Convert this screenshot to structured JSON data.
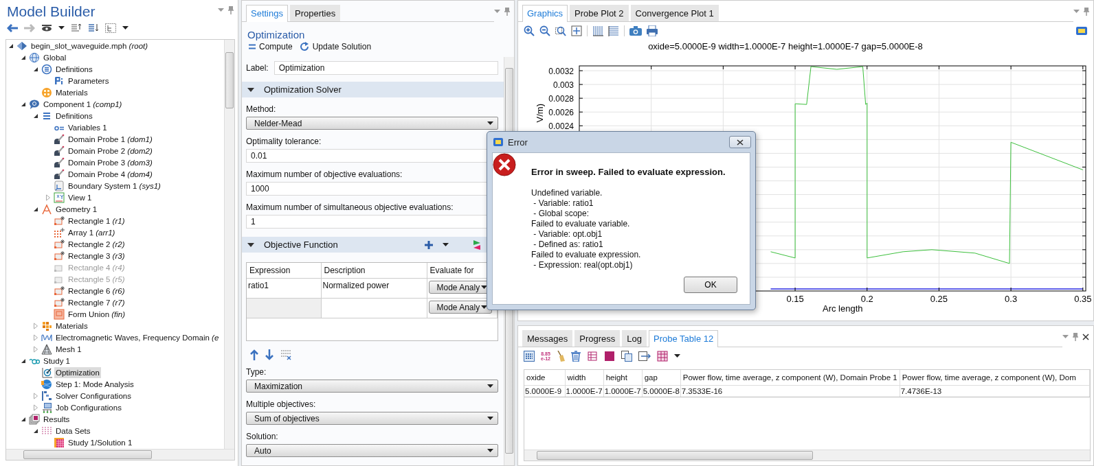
{
  "model_builder": {
    "title": "Model Builder",
    "tree": [
      {
        "label": "begin_slot_waveguide.mph *(root)*",
        "kind": "file",
        "selected": false,
        "expanded": true,
        "children": [
          {
            "label": "Global",
            "kind": "globe",
            "selected": false,
            "expanded": true,
            "children": [
              {
                "label": "Definitions",
                "kind": "definitions",
                "selected": false,
                "expanded": true,
                "children": [
                  {
                    "label": "Parameters",
                    "kind": "parameters",
                    "selected": false
                  }
                ]
              },
              {
                "label": "Materials",
                "kind": "materials",
                "selected": false
              }
            ]
          },
          {
            "label": "Component 1 *(comp1)*",
            "kind": "component",
            "selected": false,
            "expanded": true,
            "children": [
              {
                "label": "Definitions",
                "kind": "list",
                "selected": false,
                "expanded": true,
                "children": [
                  {
                    "label": "Variables 1",
                    "kind": "variables",
                    "selected": false
                  },
                  {
                    "label": "Domain Probe 1 *(dom1)*",
                    "kind": "probe",
                    "selected": false
                  },
                  {
                    "label": "Domain Probe 2 *(dom2)*",
                    "kind": "probe",
                    "selected": false
                  },
                  {
                    "label": "Domain Probe 3 *(dom3)*",
                    "kind": "probe",
                    "selected": false
                  },
                  {
                    "label": "Domain Probe 4 *(dom4)*",
                    "kind": "probe",
                    "selected": false
                  },
                  {
                    "label": "Boundary System 1 *(sys1)*",
                    "kind": "coordsys",
                    "selected": false
                  },
                  {
                    "label": "View 1",
                    "kind": "view",
                    "selected": false,
                    "expanded": false
                  }
                ]
              },
              {
                "label": "Geometry 1",
                "kind": "geometry",
                "selected": false,
                "expanded": true,
                "children": [
                  {
                    "label": "Rectangle 1 *(r1)*",
                    "kind": "rectangle",
                    "selected": false,
                    "disabled": false
                  },
                  {
                    "label": "Array 1 *(arr1)*",
                    "kind": "array",
                    "selected": false,
                    "disabled": false
                  },
                  {
                    "label": "Rectangle 2 *(r2)*",
                    "kind": "rectangle",
                    "selected": false,
                    "disabled": false
                  },
                  {
                    "label": "Rectangle 3 *(r3)*",
                    "kind": "rectangle",
                    "selected": false,
                    "disabled": false
                  },
                  {
                    "label": "Rectangle 4 *(r4)*",
                    "kind": "rectangle",
                    "selected": false,
                    "disabled": true
                  },
                  {
                    "label": "Rectangle 5 *(r5)*",
                    "kind": "rectangle",
                    "selected": false,
                    "disabled": true
                  },
                  {
                    "label": "Rectangle 6 *(r6)*",
                    "kind": "rectangle",
                    "selected": false,
                    "disabled": false
                  },
                  {
                    "label": "Rectangle 7 *(r7)*",
                    "kind": "rectangle",
                    "selected": false,
                    "disabled": false
                  },
                  {
                    "label": "Form Union *(fin)*",
                    "kind": "union",
                    "selected": false,
                    "disabled": false
                  }
                ]
              },
              {
                "label": "Materials",
                "kind": "materials2",
                "selected": false,
                "expanded": false
              },
              {
                "label": "Electromagnetic Waves, Frequency Domain *(e*",
                "kind": "physics",
                "selected": false,
                "expanded": false
              },
              {
                "label": "Mesh 1",
                "kind": "mesh",
                "selected": false,
                "expanded": false
              }
            ]
          },
          {
            "label": "Study 1",
            "kind": "study",
            "selected": false,
            "expanded": true,
            "children": [
              {
                "label": "Optimization",
                "kind": "optimization",
                "selected": true
              },
              {
                "label": "Step 1: Mode Analysis",
                "kind": "step",
                "selected": false
              },
              {
                "label": "Solver Configurations",
                "kind": "solver",
                "selected": false,
                "expanded": false
              },
              {
                "label": "Job Configurations",
                "kind": "job",
                "selected": false,
                "expanded": false
              }
            ]
          },
          {
            "label": "Results",
            "kind": "results",
            "selected": false,
            "expanded": true,
            "children": [
              {
                "label": "Data Sets",
                "kind": "datasets",
                "selected": false,
                "expanded": true,
                "children": [
                  {
                    "label": "Study 1/Solution 1",
                    "kind": "solution",
                    "selected": false
                  }
                ]
              }
            ]
          }
        ]
      }
    ]
  },
  "settings": {
    "tabs": [
      {
        "label": "Settings",
        "selected": true
      },
      {
        "label": "Properties",
        "selected": false
      }
    ],
    "title": "Optimization",
    "actions": [
      {
        "label": "Compute",
        "kind": "compute"
      },
      {
        "label": "Update Solution",
        "kind": "update"
      }
    ],
    "label_field": {
      "label": "Label:",
      "value": "Optimization"
    },
    "sections": [
      {
        "title": "Optimization Solver",
        "expanded": true,
        "fields": [
          {
            "label": "Method:",
            "kind": "dropdown",
            "value": "Nelder-Mead"
          },
          {
            "label": "Optimality tolerance:",
            "kind": "text",
            "value": "0.01"
          },
          {
            "label": "Maximum number of objective evaluations:",
            "kind": "text",
            "value": "1000"
          },
          {
            "label": "Maximum number of simultaneous objective evaluations:",
            "kind": "text",
            "value": "1"
          }
        ]
      },
      {
        "title": "Objective Function",
        "expanded": true,
        "table": {
          "columns": [
            "Expression",
            "Description",
            "Evaluate for"
          ],
          "rows": [
            {
              "expression": "ratio1",
              "description": "Normalized power",
              "evaluate_for": "Mode Analy"
            },
            {
              "evaluate_for": "Mode Analy"
            }
          ]
        },
        "fields": [
          {
            "label": "Type:",
            "kind": "dropdown",
            "value": "Maximization"
          },
          {
            "label": "Multiple objectives:",
            "kind": "dropdown",
            "value": "Sum of objectives"
          },
          {
            "label": "Solution:",
            "kind": "dropdown",
            "value": "Auto"
          }
        ]
      }
    ]
  },
  "graphics": {
    "tabs": [
      {
        "label": "Graphics",
        "selected": true
      },
      {
        "label": "Probe Plot 2",
        "selected": false
      },
      {
        "label": "Convergence Plot 1",
        "selected": false
      }
    ],
    "chart_data": {
      "type": "line",
      "title": "oxide=5.0000E-9 width=1.0000E-7 height=1.0000E-7 gap=5.0000E-8",
      "xlabel": "Arc length",
      "ylabel": "V/m)",
      "x": [
        0.133,
        0.15,
        0.15,
        0.158,
        0.161,
        0.179,
        0.197,
        0.199,
        0.2,
        0.2,
        0.225,
        0.245,
        0.275,
        0.299,
        0.3,
        0.35
      ],
      "series": [
        {
          "color": "#3cbf3c",
          "values": [
            0.00057,
            0.00048,
            0.00272,
            0.00271,
            0.00326,
            0.00322,
            0.00326,
            0.00271,
            0.00273,
            0.00048,
            0.00057,
            0.0006,
            0.00055,
            0.0004,
            0.00216,
            0.00176
          ]
        },
        {
          "color": "#2a2ae0",
          "values": [
            3e-05,
            3e-05,
            3e-05,
            3e-05,
            3e-05,
            3e-05,
            3e-05,
            3e-05,
            3e-05,
            3e-05,
            3e-05,
            3e-05,
            3e-05,
            3e-05,
            3e-05,
            3e-05
          ]
        }
      ],
      "grid": true,
      "xlim": [
        0,
        0.352
      ],
      "ylim": [
        0,
        0.00327
      ],
      "xticks": [
        0.15,
        0.2,
        0.25,
        0.3,
        0.35
      ],
      "yticks": [
        0.0024,
        0.0026,
        0.0028,
        0.003,
        0.0032
      ]
    }
  },
  "results_panel": {
    "tabs": [
      {
        "label": "Messages",
        "selected": false
      },
      {
        "label": "Progress",
        "selected": false
      },
      {
        "label": "Log",
        "selected": false
      },
      {
        "label": "Probe Table 12",
        "selected": true
      }
    ],
    "format_button": [
      "8.85",
      "e-12"
    ],
    "table": {
      "columns": [
        "oxide",
        "width",
        "height",
        "gap",
        "Power flow, time average, z component (W), Domain Probe 1",
        "Power flow, time average, z component (W), Dom"
      ],
      "rows": [
        [
          "5.0000E-9",
          "1.0000E-7",
          "1.0000E-7",
          "5.0000E-8",
          "7.3533E-16",
          "7.4736E-13"
        ]
      ]
    }
  },
  "dialog": {
    "title": "Error",
    "heading": "Error in sweep. Failed to evaluate expression.",
    "lines": [
      "Undefined variable.",
      " - Variable: ratio1",
      " - Global scope:",
      "Failed to evaluate variable.",
      " - Variable: opt.obj1",
      " - Defined as: ratio1",
      "Failed to evaluate expression.",
      " - Expression: real(opt.obj1)"
    ],
    "button": "OK"
  }
}
